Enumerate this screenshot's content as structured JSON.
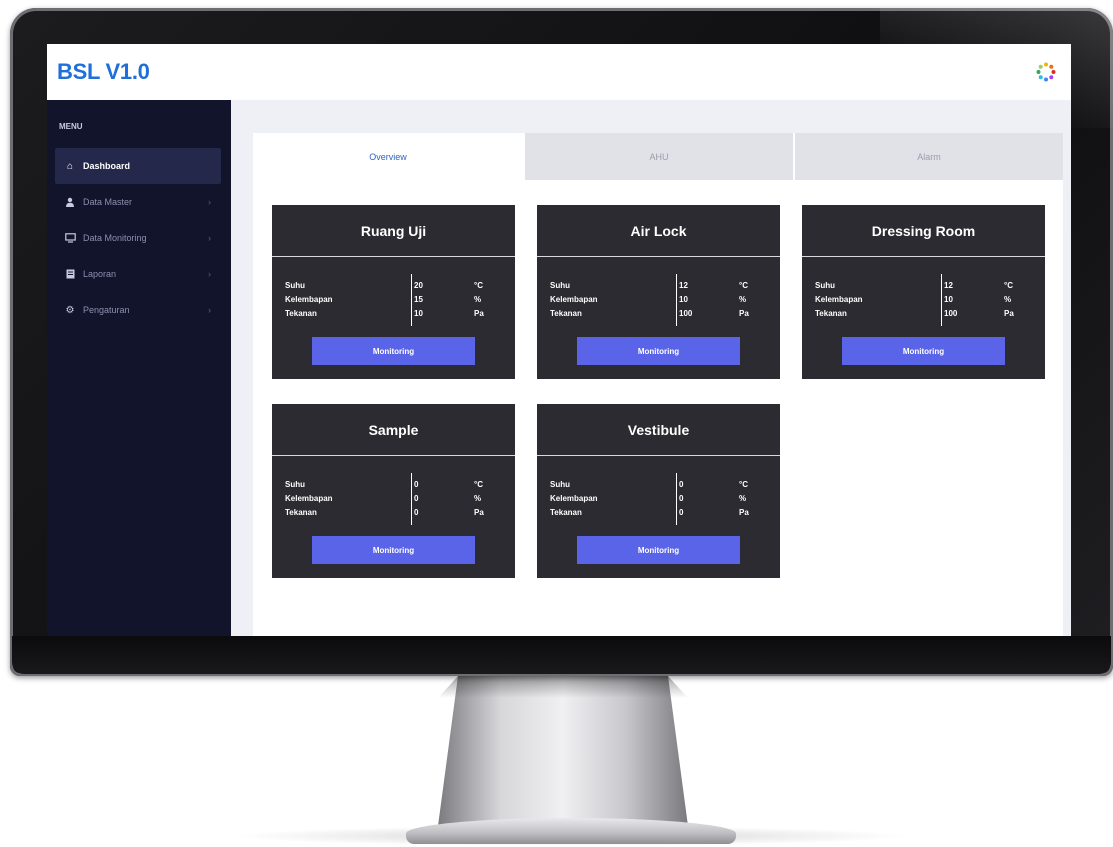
{
  "app": {
    "logo_text": "BSL V1.0"
  },
  "sidebar": {
    "menu_title": "MENU",
    "items": [
      {
        "label": "Dashboard",
        "icon": "home-icon",
        "active": true
      },
      {
        "label": "Data Master",
        "icon": "user-icon",
        "active": false
      },
      {
        "label": "Data Monitoring",
        "icon": "monitor-icon",
        "active": false
      },
      {
        "label": "Laporan",
        "icon": "document-icon",
        "active": false
      },
      {
        "label": "Pengaturan",
        "icon": "gear-icon",
        "active": false
      }
    ]
  },
  "tabs": [
    {
      "label": "Overview",
      "active": true
    },
    {
      "label": "AHU",
      "active": false
    },
    {
      "label": "Alarm",
      "active": false
    }
  ],
  "cards": [
    {
      "title": "Ruang Uji",
      "rows": [
        {
          "label": "Suhu",
          "value": "20",
          "unit": "°C"
        },
        {
          "label": "Kelembapan",
          "value": "15",
          "unit": "%"
        },
        {
          "label": "Tekanan",
          "value": "10",
          "unit": "Pa"
        }
      ],
      "button": "Monitoring"
    },
    {
      "title": "Air Lock",
      "rows": [
        {
          "label": "Suhu",
          "value": "12",
          "unit": "°C"
        },
        {
          "label": "Kelembapan",
          "value": "10",
          "unit": "%"
        },
        {
          "label": "Tekanan",
          "value": "100",
          "unit": "Pa"
        }
      ],
      "button": "Monitoring"
    },
    {
      "title": "Dressing Room",
      "rows": [
        {
          "label": "Suhu",
          "value": "12",
          "unit": "°C"
        },
        {
          "label": "Kelembapan",
          "value": "10",
          "unit": "%"
        },
        {
          "label": "Tekanan",
          "value": "100",
          "unit": "Pa"
        }
      ],
      "button": "Monitoring"
    },
    {
      "title": "Sample",
      "rows": [
        {
          "label": "Suhu",
          "value": "0",
          "unit": "°C"
        },
        {
          "label": "Kelembapan",
          "value": "0",
          "unit": "%"
        },
        {
          "label": "Tekanan",
          "value": "0",
          "unit": "Pa"
        }
      ],
      "button": "Monitoring"
    },
    {
      "title": "Vestibule",
      "rows": [
        {
          "label": "Suhu",
          "value": "0",
          "unit": "°C"
        },
        {
          "label": "Kelembapan",
          "value": "0",
          "unit": "%"
        },
        {
          "label": "Tekanan",
          "value": "0",
          "unit": "Pa"
        }
      ],
      "button": "Monitoring"
    }
  ],
  "colors": {
    "accent": "#1f6fd8",
    "sidebar_bg": "#12142b",
    "card_bg": "#2b2b31",
    "button_bg": "#5a64e8"
  }
}
